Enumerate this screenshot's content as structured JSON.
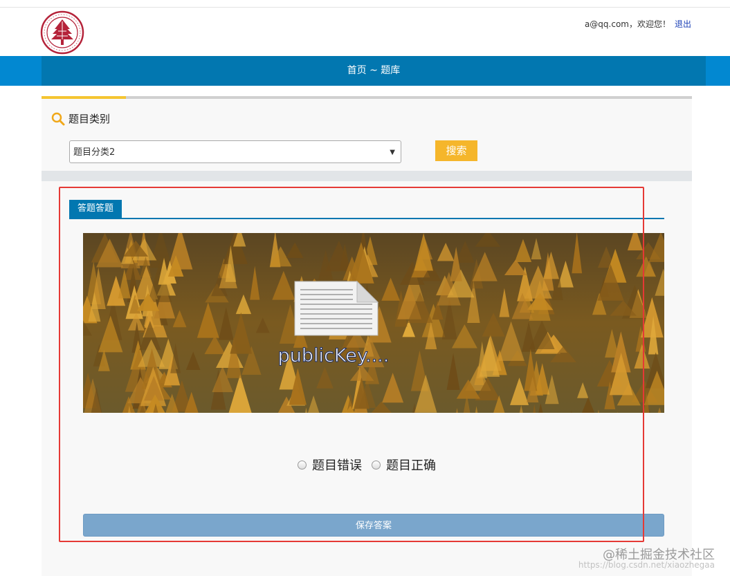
{
  "header": {
    "user_email_greeting": "a@qq.com，欢迎您！",
    "logout_label": "退出"
  },
  "nav": {
    "breadcrumb": "首页 ~ 题库"
  },
  "category": {
    "title": "题目类别",
    "selected": "题目分类2",
    "search_label": "搜索"
  },
  "question": {
    "tab_label": "答题答题",
    "image_caption": "publicKey....",
    "options": [
      "题目错误",
      "题目正确"
    ],
    "save_label": "保存答案"
  },
  "colors": {
    "nav_blue": "#0277b0",
    "accent_yellow": "#f5c531",
    "search_orange": "#f5b62b",
    "save_button": "#7aa6cc",
    "highlight_red": "#e53935"
  },
  "watermark": {
    "line1": "@稀土掘金技术社区",
    "line2": "https://blog.csdn.net/xiaozhegaa"
  }
}
